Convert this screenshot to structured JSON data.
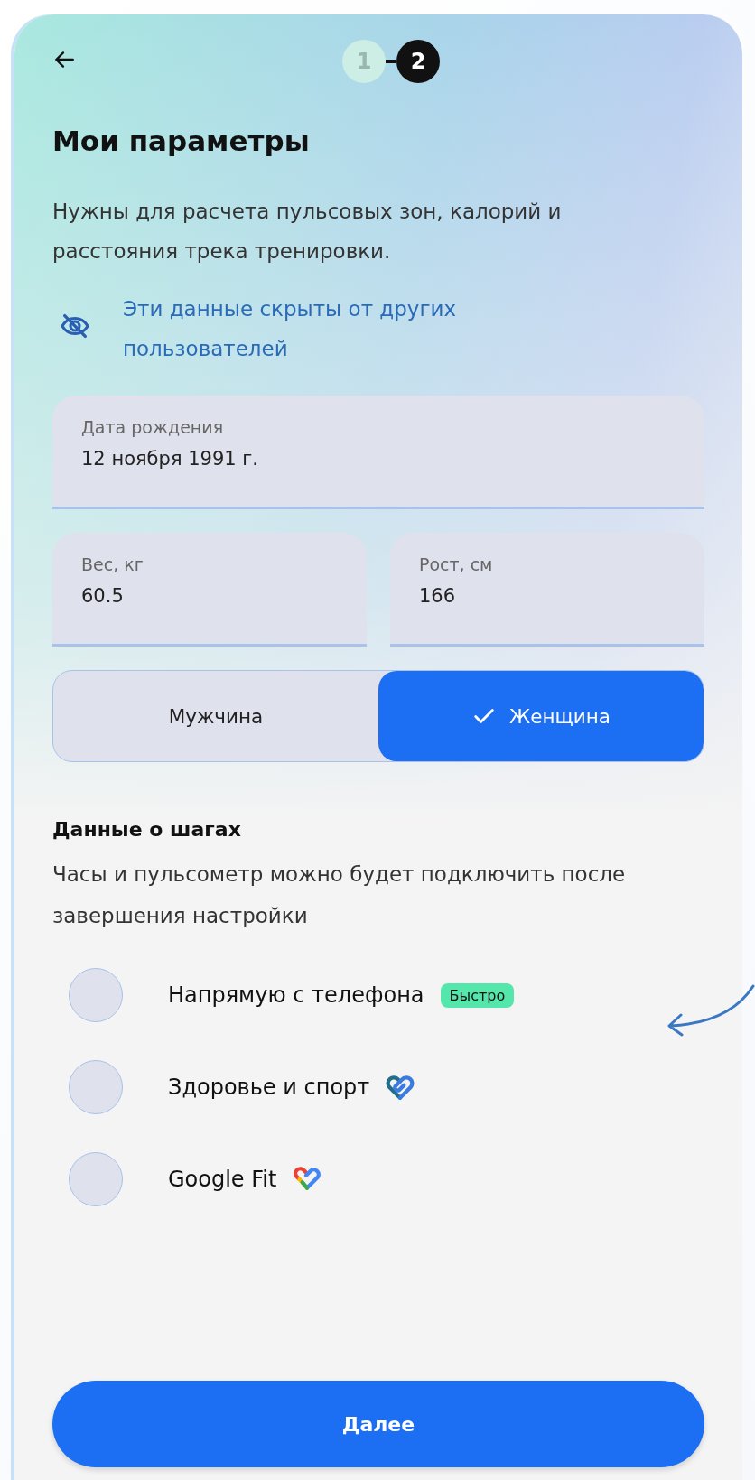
{
  "steps": [
    {
      "label": "1",
      "current": false
    },
    {
      "label": "2",
      "current": true
    }
  ],
  "title": "Мои параметры",
  "description": "Нужны для расчета пульсовых зон, калорий и расстояния трека тренировки.",
  "privacy_note": "Эти данные скрыты от других пользователей",
  "fields": [
    {
      "label": "Дата рождения",
      "value": "12 ноября 1991 г."
    },
    {
      "label": "Вес, кг",
      "value": "60.5"
    },
    {
      "label": "Рост, см",
      "value": "166"
    }
  ],
  "gender": [
    {
      "label": "Мужчина",
      "selected": false
    },
    {
      "label": "Женщина",
      "selected": true
    }
  ],
  "steps_section": {
    "title": "Данные о шагах",
    "description": "Часы и пульсометр можно будет подключить после завершения настройки"
  },
  "sources": [
    {
      "label": "Напрямую с телефона",
      "selected": false,
      "badge": "Быстро"
    },
    {
      "label": "Здоровье и спорт",
      "selected": false
    },
    {
      "label": "Google Fit",
      "selected": false
    }
  ],
  "next_button": "Далее"
}
